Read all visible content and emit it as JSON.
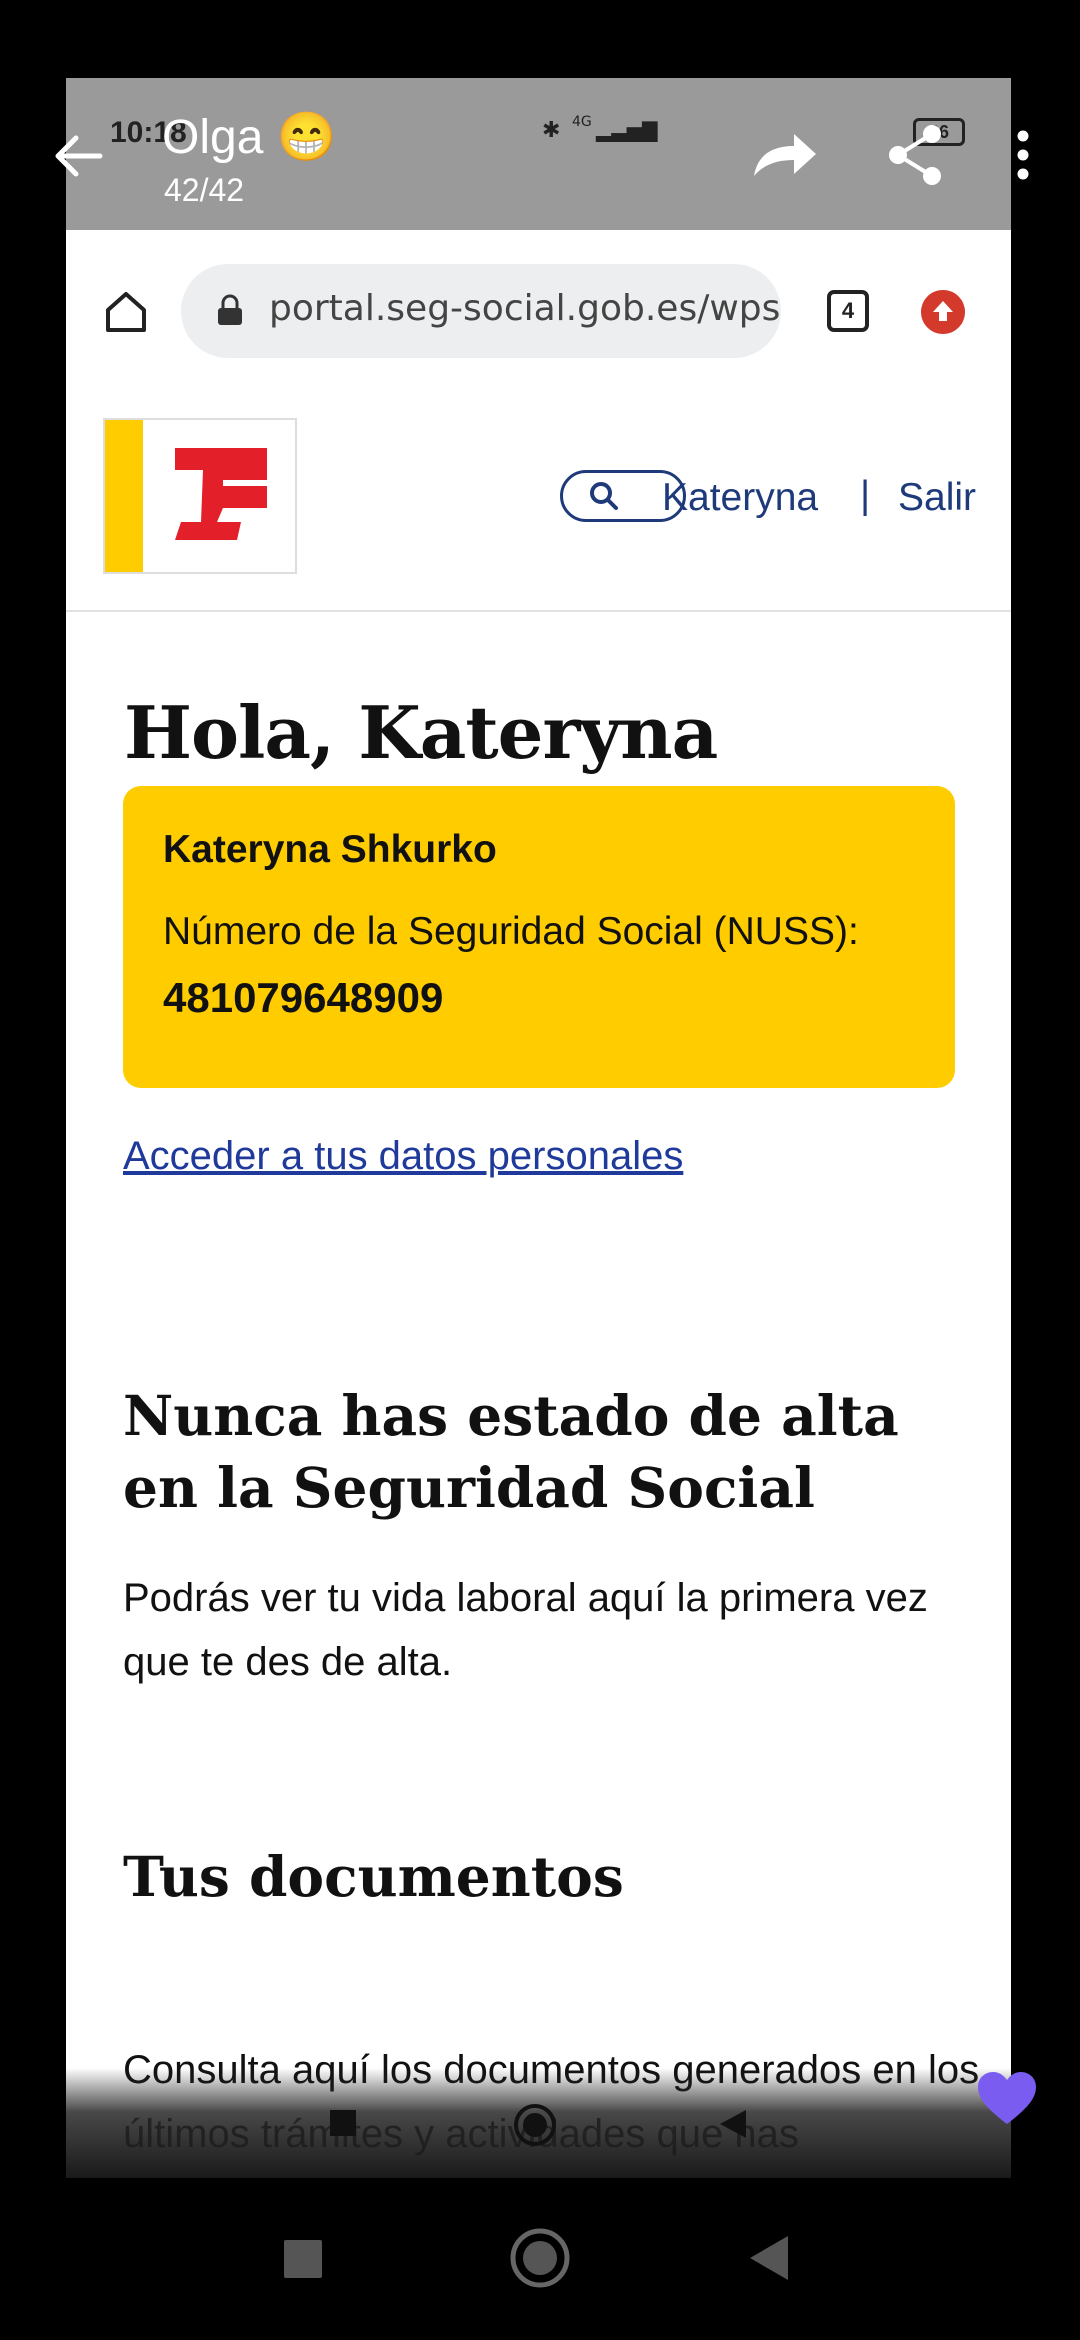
{
  "viewer": {
    "sender": "Olga 😁",
    "counter": "42/42"
  },
  "status": {
    "time": "10:18",
    "battery": "36",
    "network": "4G"
  },
  "browser": {
    "url": "portal.seg-social.gob.es/wps",
    "tabs": "4"
  },
  "header": {
    "user": "Kateryna",
    "separator": "|",
    "logout": "Salir"
  },
  "main": {
    "greeting": "Hola, Kateryna",
    "card": {
      "name": "Kateryna Shkurko",
      "label": "Número de la Seguridad Social (NUSS):",
      "number": "481079648909"
    },
    "personal_link": "Acceder a tus datos personales",
    "alta_title": "Nunca has estado de alta en la Seguridad Social",
    "alta_text": "Podrás ver tu vida laboral aquí la primera vez que te des de alta.",
    "docs_title": "Tus documentos",
    "docs_text": "Consulta aquí los documentos generados en los últimos trámites y actividades que has"
  },
  "colors": {
    "brand_yellow": "#ffcc00",
    "brand_red": "#e3202a",
    "link_blue": "#1f3a9a"
  }
}
